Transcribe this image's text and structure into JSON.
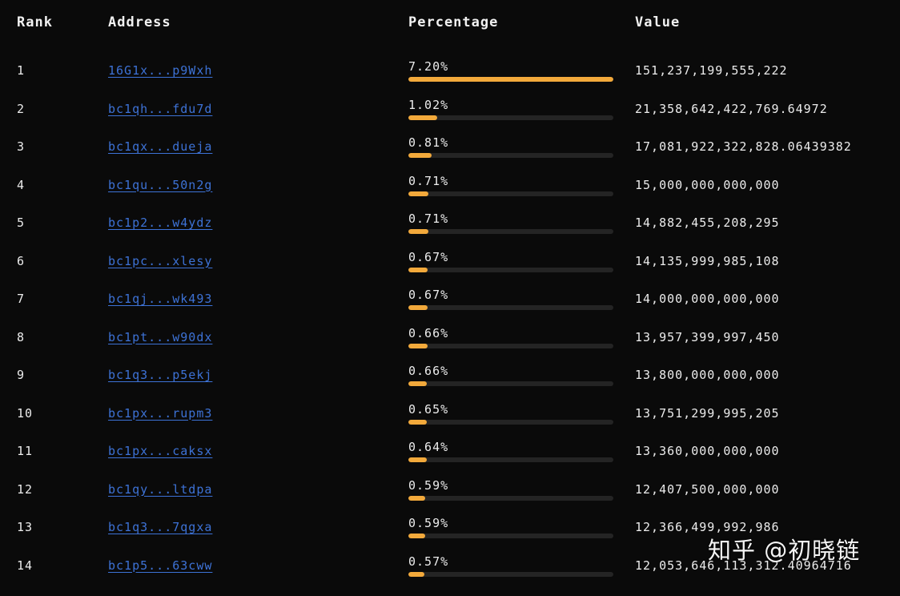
{
  "header": {
    "rank": "Rank",
    "address": "Address",
    "percentage": "Percentage",
    "value": "Value"
  },
  "colors": {
    "background": "#0a0a0a",
    "bar_fill": "#f2a93b",
    "bar_track": "#242424",
    "link": "#3d72d6"
  },
  "rows": [
    {
      "rank": "1",
      "address": "16G1x...p9Wxh",
      "percentage": "7.20%",
      "fill": 1.0,
      "value": "151,237,199,555,222"
    },
    {
      "rank": "2",
      "address": "bc1qh...fdu7d",
      "percentage": "1.02%",
      "fill": 0.142,
      "value": "21,358,642,422,769.64972"
    },
    {
      "rank": "3",
      "address": "bc1qx...dueja",
      "percentage": "0.81%",
      "fill": 0.113,
      "value": "17,081,922,322,828.06439382"
    },
    {
      "rank": "4",
      "address": "bc1qu...50n2g",
      "percentage": "0.71%",
      "fill": 0.099,
      "value": "15,000,000,000,000"
    },
    {
      "rank": "5",
      "address": "bc1p2...w4ydz",
      "percentage": "0.71%",
      "fill": 0.098,
      "value": "14,882,455,208,295"
    },
    {
      "rank": "6",
      "address": "bc1pc...xlesy",
      "percentage": "0.67%",
      "fill": 0.093,
      "value": "14,135,999,985,108"
    },
    {
      "rank": "7",
      "address": "bc1qj...wk493",
      "percentage": "0.67%",
      "fill": 0.093,
      "value": "14,000,000,000,000"
    },
    {
      "rank": "8",
      "address": "bc1pt...w90dx",
      "percentage": "0.66%",
      "fill": 0.092,
      "value": "13,957,399,997,450"
    },
    {
      "rank": "9",
      "address": "bc1q3...p5ekj",
      "percentage": "0.66%",
      "fill": 0.091,
      "value": "13,800,000,000,000"
    },
    {
      "rank": "10",
      "address": "bc1px...rupm3",
      "percentage": "0.65%",
      "fill": 0.091,
      "value": "13,751,299,995,205"
    },
    {
      "rank": "11",
      "address": "bc1px...caksx",
      "percentage": "0.64%",
      "fill": 0.088,
      "value": "13,360,000,000,000"
    },
    {
      "rank": "12",
      "address": "bc1qy...ltdpa",
      "percentage": "0.59%",
      "fill": 0.082,
      "value": "12,407,500,000,000"
    },
    {
      "rank": "13",
      "address": "bc1q3...7qgxa",
      "percentage": "0.59%",
      "fill": 0.082,
      "value": "12,366,499,992,986"
    },
    {
      "rank": "14",
      "address": "bc1p5...63cww",
      "percentage": "0.57%",
      "fill": 0.079,
      "value": "12,053,646,113,312.40964716"
    }
  ],
  "watermark": "知乎 @初晓链"
}
